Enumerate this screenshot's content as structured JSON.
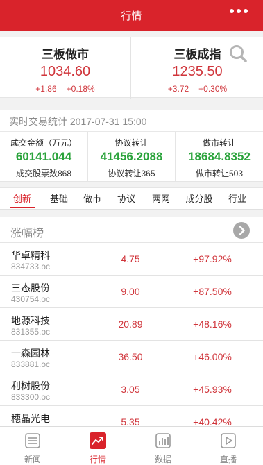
{
  "header": {
    "title": "行情"
  },
  "indices": [
    {
      "name": "三板做市",
      "value": "1034.60",
      "change": "+1.86",
      "percent": "+0.18%"
    },
    {
      "name": "三板成指",
      "value": "1235.50",
      "change": "+3.72",
      "percent": "+0.30%"
    }
  ],
  "stats": {
    "title": "实时交易统计 2017-07-31 15:00",
    "items": [
      {
        "label": "成交金额（万元）",
        "value": "60141.044",
        "sub": "成交股票数868"
      },
      {
        "label": "协议转让",
        "value": "41456.2088",
        "sub": "协议转让365"
      },
      {
        "label": "做市转让",
        "value": "18684.8352",
        "sub": "做市转让503"
      }
    ]
  },
  "tabs": [
    "创新",
    "基础",
    "做市",
    "协议",
    "两网",
    "成分股",
    "行业"
  ],
  "active_tab": 0,
  "ranking": {
    "title": "涨幅榜",
    "rows": [
      {
        "name": "华卓精科",
        "code": "834733.oc",
        "price": "4.75",
        "percent": "+97.92%"
      },
      {
        "name": "三态股份",
        "code": "430754.oc",
        "price": "9.00",
        "percent": "+87.50%"
      },
      {
        "name": "地源科技",
        "code": "831355.oc",
        "price": "20.89",
        "percent": "+48.16%"
      },
      {
        "name": "一森园林",
        "code": "833881.oc",
        "price": "36.50",
        "percent": "+46.00%"
      },
      {
        "name": "利树股份",
        "code": "833300.oc",
        "price": "3.05",
        "percent": "+45.93%"
      },
      {
        "name": "穗晶光电",
        "code": "",
        "price": "5.35",
        "percent": "+40.42%"
      }
    ]
  },
  "tabbar": [
    {
      "label": "新闻",
      "icon": "news-icon"
    },
    {
      "label": "行情",
      "icon": "market-trend-icon"
    },
    {
      "label": "数据",
      "icon": "data-chart-icon"
    },
    {
      "label": "直播",
      "icon": "live-play-icon"
    }
  ],
  "active_tabbar": 1,
  "colors": {
    "brand": "#d9232b",
    "up": "#d0353b",
    "green": "#2aa33b"
  }
}
